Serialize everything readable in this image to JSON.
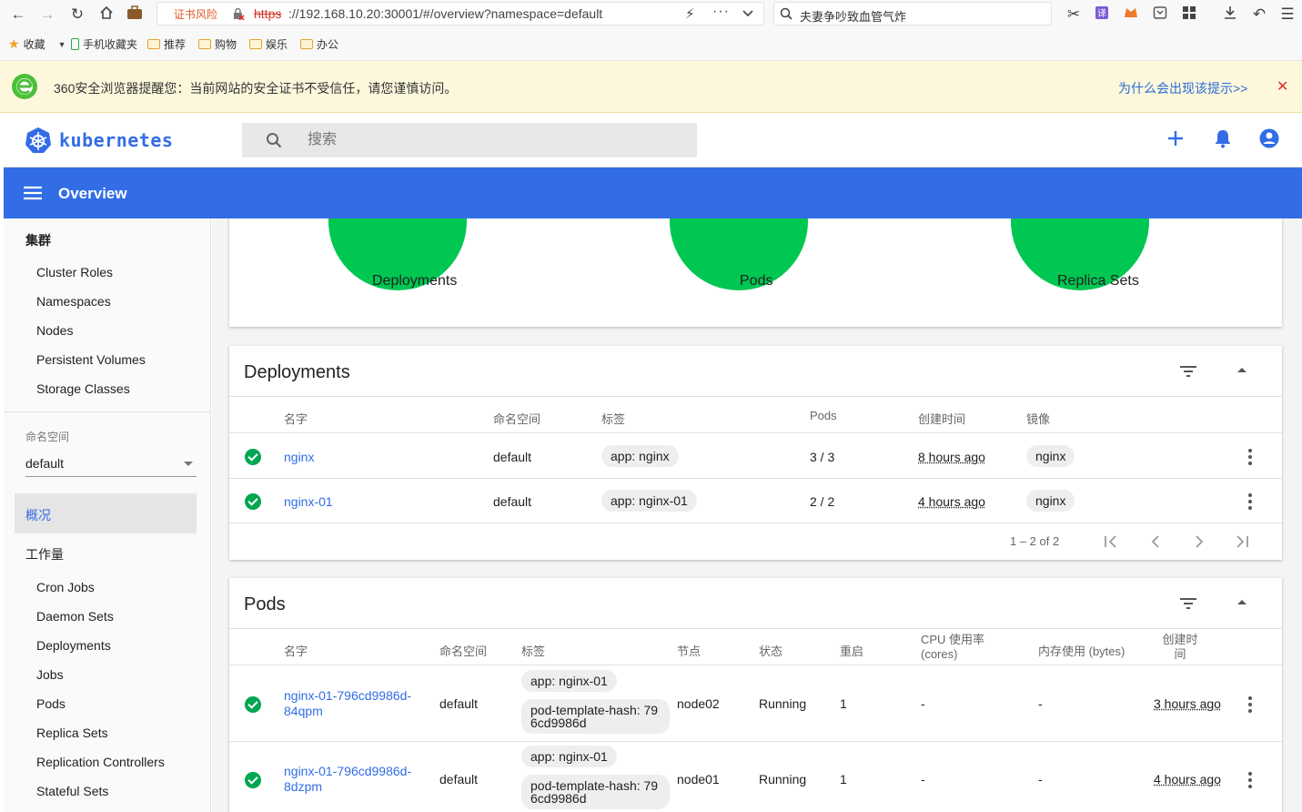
{
  "browser": {
    "cert_warning": "证书风险",
    "url_scheme": "https",
    "url_rest": "://192.168.10.20:30001/#/overview?namespace=default",
    "search_text": "夫妻争吵致血管气炸",
    "bookmarks": [
      "收藏",
      "手机收藏夹",
      "推荐",
      "购物",
      "娱乐",
      "办公"
    ]
  },
  "warning_bar": {
    "message": "360安全浏览器提醒您：当前网站的安全证书不受信任，请您谨慎访问。",
    "link": "为什么会出现该提示>>",
    "close": "✕"
  },
  "app": {
    "brand": "kubernetes",
    "search_placeholder": "搜索",
    "page_title": "Overview"
  },
  "sidebar": {
    "cluster_header": "集群",
    "cluster_items": [
      "Cluster Roles",
      "Namespaces",
      "Nodes",
      "Persistent Volumes",
      "Storage Classes"
    ],
    "namespace_label": "命名空间",
    "namespace_value": "default",
    "overview": "概况",
    "workloads_header": "工作量",
    "workload_items": [
      "Cron Jobs",
      "Daemon Sets",
      "Deployments",
      "Jobs",
      "Pods",
      "Replica Sets",
      "Replication Controllers",
      "Stateful Sets"
    ]
  },
  "summary": {
    "labels": [
      "Deployments",
      "Pods",
      "Replica Sets"
    ],
    "accent": "#00c752"
  },
  "deployments": {
    "title": "Deployments",
    "columns": [
      "名字",
      "命名空间",
      "标签",
      "Pods",
      "创建时间",
      "镜像"
    ],
    "rows": [
      {
        "name": "nginx",
        "namespace": "default",
        "label": "app: nginx",
        "pods": "3 / 3",
        "created": "8 hours ago",
        "image": "nginx"
      },
      {
        "name": "nginx-01",
        "namespace": "default",
        "label": "app: nginx-01",
        "pods": "2 / 2",
        "created": "4 hours ago",
        "image": "nginx"
      }
    ],
    "pagination": "1 – 2 of 2"
  },
  "pods": {
    "title": "Pods",
    "columns": [
      "名字",
      "命名空间",
      "标签",
      "节点",
      "状态",
      "重启",
      "CPU 使用率 (cores)",
      "内存使用 (bytes)",
      "创建时间"
    ],
    "rows": [
      {
        "name_line1": "nginx-01-796cd9986d-",
        "name_line2": "84qpm",
        "namespace": "default",
        "label1": "app: nginx-01",
        "label2_line1": "pod-template-hash: 79",
        "label2_line2": "6cd9986d",
        "node": "node02",
        "status": "Running",
        "restarts": "1",
        "cpu": "-",
        "memory": "-",
        "created": "3 hours ago"
      },
      {
        "name_line1": "nginx-01-796cd9986d-",
        "name_line2": "8dzpm",
        "namespace": "default",
        "label1": "app: nginx-01",
        "label2_line1": "pod-template-hash: 79",
        "label2_line2": "6cd9986d",
        "node": "node01",
        "status": "Running",
        "restarts": "1",
        "cpu": "-",
        "memory": "-",
        "created": "4 hours ago"
      }
    ]
  },
  "colors": {
    "primary": "#326de6",
    "success": "#00a651",
    "warning_bg": "#fdf8dc"
  }
}
